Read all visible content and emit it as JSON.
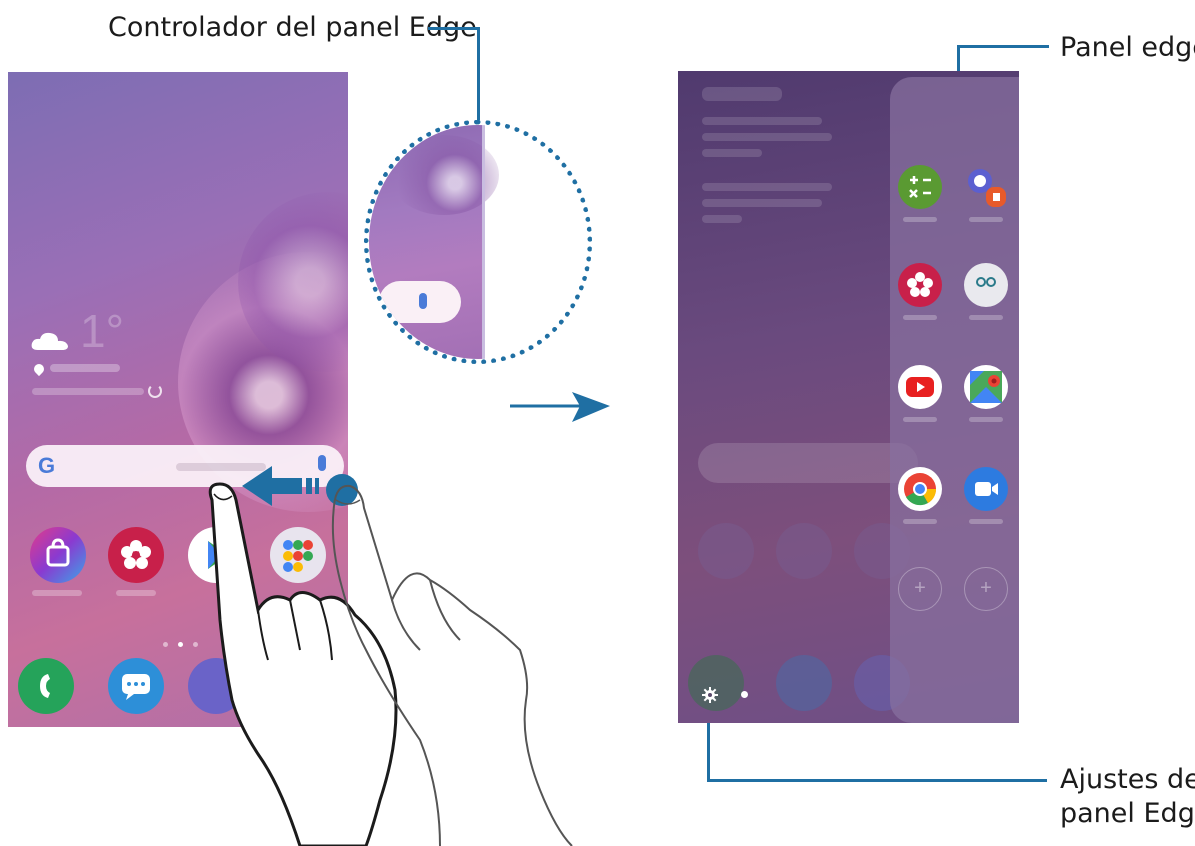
{
  "labels": {
    "handle": "Controlador del panel Edge",
    "panel": "Panel edge",
    "settings_line1": "Ajustes del",
    "settings_line2": "panel Edge"
  },
  "left_screen": {
    "search_logo": "G",
    "home_apps": [
      "galaxy-store-icon",
      "gallery-icon",
      "play-store-icon",
      "google-folder-icon"
    ],
    "dock_apps": [
      "phone-icon",
      "messages-icon",
      "internet-icon"
    ],
    "weather_icon": "cloud-icon"
  },
  "right_screen": {
    "edge_apps": [
      "calculator-icon",
      "internet-notes-icon",
      "gallery-icon",
      "bixby-icon",
      "youtube-icon",
      "maps-icon",
      "chrome-icon",
      "video-icon"
    ],
    "add_slots": [
      "+",
      "+"
    ],
    "settings_icon": "gear-icon"
  },
  "colors": {
    "leader": "#1f6fa3",
    "swipe_arrow": "#1f6fa3"
  }
}
